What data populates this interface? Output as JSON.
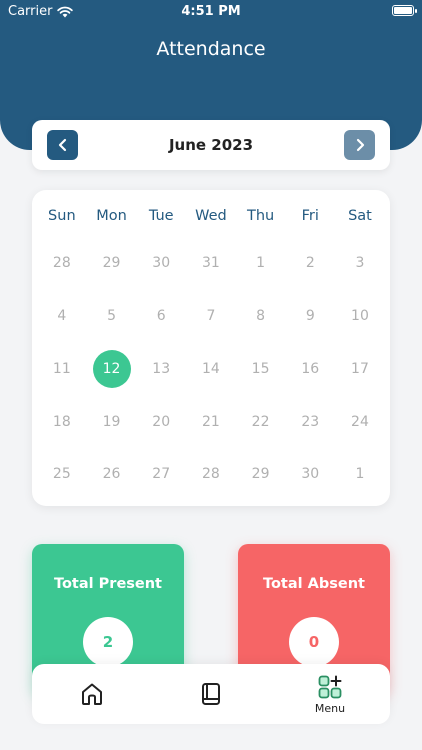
{
  "status_bar": {
    "carrier": "Carrier",
    "time": "4:51 PM"
  },
  "header": {
    "title": "Attendance"
  },
  "month_nav": {
    "month": "June 2023"
  },
  "calendar": {
    "weekdays": [
      "Sun",
      "Mon",
      "Tue",
      "Wed",
      "Thu",
      "Fri",
      "Sat"
    ],
    "weeks": [
      [
        "28",
        "29",
        "30",
        "31",
        "1",
        "2",
        "3"
      ],
      [
        "4",
        "5",
        "6",
        "7",
        "8",
        "9",
        "10"
      ],
      [
        "11",
        "12",
        "13",
        "14",
        "15",
        "16",
        "17"
      ],
      [
        "18",
        "19",
        "20",
        "21",
        "22",
        "23",
        "24"
      ],
      [
        "25",
        "26",
        "27",
        "28",
        "29",
        "30",
        "1"
      ]
    ],
    "selected_day": "12"
  },
  "summary": {
    "present_label": "Total Present",
    "present_count": "2",
    "absent_label": "Total Absent",
    "absent_count": "0"
  },
  "bottom_nav": {
    "home_icon": "home-icon",
    "book_icon": "book-icon",
    "menu_icon": "grid-plus-icon",
    "menu_label": "Menu"
  },
  "colors": {
    "primary": "#245a80",
    "present": "#3cc792",
    "absent": "#f66566"
  }
}
